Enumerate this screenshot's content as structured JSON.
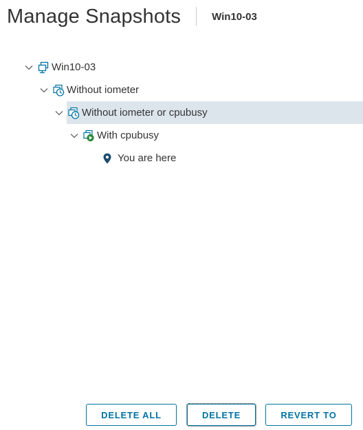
{
  "header": {
    "title": "Manage Snapshots",
    "vm_name": "Win10-03"
  },
  "tree": {
    "items": [
      {
        "label": "Win10-03",
        "icon": "vm-icon",
        "expanded": true,
        "selected": false
      },
      {
        "label": "Without iometer",
        "icon": "snapshot-icon",
        "expanded": true,
        "selected": false
      },
      {
        "label": "Without iometer or cpubusy",
        "icon": "snapshot-icon",
        "expanded": true,
        "selected": true
      },
      {
        "label": "With cpubusy",
        "icon": "snapshot-running-icon",
        "expanded": true,
        "selected": false
      },
      {
        "label": "You are here",
        "icon": "location-pin-icon",
        "selected": false
      }
    ]
  },
  "footer": {
    "delete_all_label": "DELETE ALL",
    "delete_label": "DELETE",
    "revert_to_label": "REVERT TO"
  },
  "colors": {
    "accent": "#0072a3",
    "selected_row": "#dde5ec",
    "snapshot_icon": "#0072a3",
    "running_badge": "#2e8a3e",
    "pin": "#1d4d6f"
  }
}
